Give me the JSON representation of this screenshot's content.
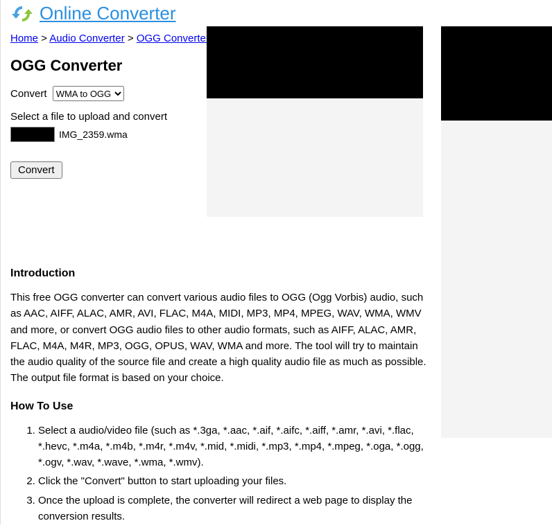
{
  "header": {
    "site_title": "Online Converter"
  },
  "breadcrumb": {
    "items": [
      "Home",
      "Audio Converter",
      "OGG Converter"
    ],
    "sep": ">"
  },
  "page_title": "OGG Converter",
  "form": {
    "convert_label": "Convert",
    "format_selected": "WMA to OGG",
    "select_file_label": "Select a file to upload and convert",
    "file_name": "IMG_2359.wma",
    "convert_button": "Convert"
  },
  "sections": {
    "intro_heading": "Introduction",
    "intro_body": "This free OGG converter can convert various audio files to OGG (Ogg Vorbis) audio, such as AAC, AIFF, ALAC, AMR, AVI, FLAC, M4A, MIDI, MP3, MP4, MPEG, WAV, WMA, WMV and more, or convert OGG audio files to other audio formats, such as AIFF, ALAC, AMR, FLAC, M4A, M4R, MP3, OGG, OPUS, WAV, WMA and more. The tool will try to maintain the audio quality of the source file and create a high quality audio file as much as possible. The output file format is based on your choice.",
    "howto_heading": "How To Use",
    "howto_steps": [
      "Select a audio/video file (such as *.3ga, *.aac, *.aif, *.aifc, *.aiff, *.amr, *.avi, *.flac, *.hevc, *.m4a, *.m4b, *.m4r, *.m4v, *.mid, *.midi, *.mp3, *.mp4, *.mpeg, *.oga, *.ogg, *.ogv, *.wav, *.wave, *.wma, *.wmv).",
      "Click the \"Convert\" button to start uploading your files.",
      "Once the upload is complete, the converter will redirect a web page to display the conversion results."
    ]
  }
}
